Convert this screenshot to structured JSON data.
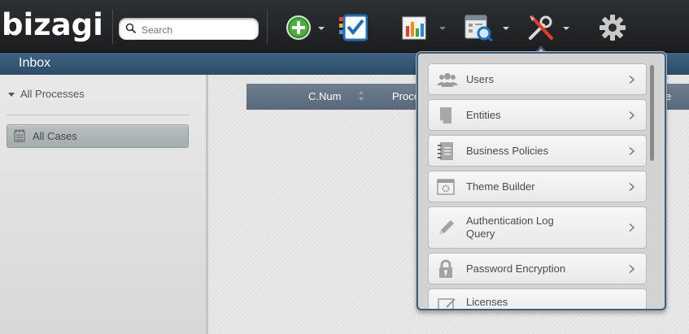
{
  "app": {
    "logo_text": "bizagi"
  },
  "search": {
    "placeholder": "Search"
  },
  "toolbar": {
    "items": [
      {
        "name": "new-case",
        "icon": "plus-circle-icon"
      },
      {
        "name": "my-tasks",
        "icon": "checklist-icon"
      },
      {
        "name": "analysis",
        "icon": "bar-chart-icon"
      },
      {
        "name": "queries",
        "icon": "calendar-search-icon"
      },
      {
        "name": "admin",
        "icon": "tools-icon"
      },
      {
        "name": "settings",
        "icon": "gear-icon"
      }
    ]
  },
  "inbox": {
    "title": "Inbox"
  },
  "left": {
    "all_processes": "All Processes",
    "all_cases": "All Cases"
  },
  "grid": {
    "columns": [
      "C.Num",
      "Proce",
      "e"
    ]
  },
  "admin_menu": {
    "items": [
      {
        "label": "Users",
        "icon": "users-icon"
      },
      {
        "label": "Entities",
        "icon": "entity-icon"
      },
      {
        "label": "Business Policies",
        "icon": "policy-notebook-icon"
      },
      {
        "label": "Theme Builder",
        "icon": "theme-window-icon"
      },
      {
        "label": "Authentication Log Query",
        "icon": "pencil-icon"
      },
      {
        "label": "Password Encryption",
        "icon": "lock-icon"
      },
      {
        "label": "Licenses",
        "icon": "license-icon"
      }
    ]
  },
  "colors": {
    "topbar": "#1f2124",
    "inbox_bar": "#34557a",
    "menu_border": "#3f5d76"
  }
}
